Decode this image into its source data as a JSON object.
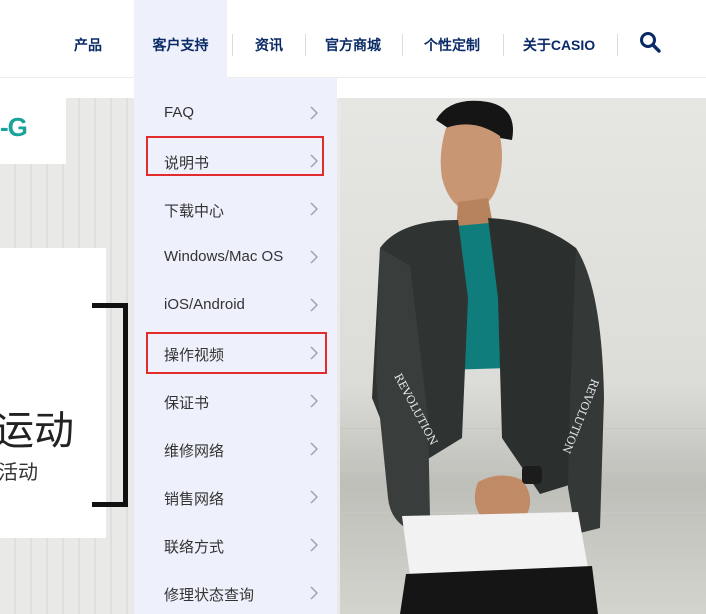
{
  "nav": {
    "items": [
      {
        "label": "产品"
      },
      {
        "label": "客户支持",
        "active": true
      },
      {
        "label": "资讯"
      },
      {
        "label": "官方商城"
      },
      {
        "label": "个性定制"
      },
      {
        "label": "关于CASIO"
      }
    ],
    "search_icon": "search-icon",
    "text_color": "#0a2a66"
  },
  "support_menu": {
    "items": [
      {
        "label": "FAQ"
      },
      {
        "label": "说明书",
        "highlighted": true
      },
      {
        "label": "下载中心"
      },
      {
        "label": "Windows/Mac OS"
      },
      {
        "label": "iOS/Android"
      },
      {
        "label": "操作视频",
        "highlighted": true
      },
      {
        "label": "保证书"
      },
      {
        "label": "维修网络"
      },
      {
        "label": "销售网络"
      },
      {
        "label": "联络方式"
      },
      {
        "label": "修理状态查询"
      }
    ],
    "chevron_icon": "chevron-right-icon",
    "highlight_color": "#e32b2b",
    "background": "#eef1fb"
  },
  "hero": {
    "logo_text": "-G",
    "logo_color": "#1aa39b",
    "promo_big": "运动",
    "promo_small": "活动",
    "sleeve_text_left": "REVOLUTION",
    "sleeve_text_right": "REVOLUTION"
  }
}
